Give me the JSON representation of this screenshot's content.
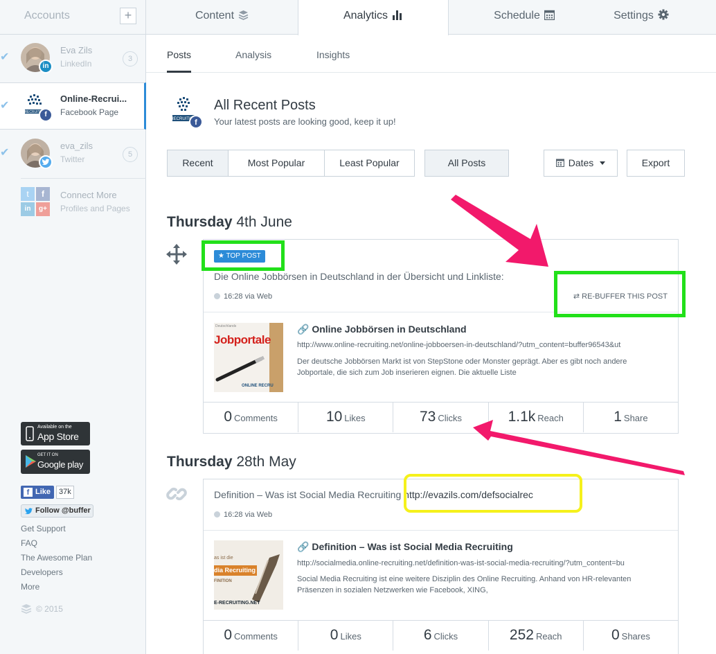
{
  "sidebar": {
    "title": "Accounts",
    "add_icon": "plus-icon",
    "accounts": [
      {
        "name": "Eva Zils",
        "network": "LinkedIn",
        "count": "3",
        "network_icon": "linkedin-icon"
      },
      {
        "name": "Online-Recrui...",
        "network": "Facebook Page",
        "network_icon": "facebook-icon"
      },
      {
        "name": "eva_zils",
        "network": "Twitter",
        "count": "5",
        "network_icon": "twitter-icon"
      }
    ],
    "connect": {
      "title": "Connect More",
      "sub": "Profiles and Pages"
    },
    "appstore": {
      "line1": "Available on the",
      "line2": "App Store"
    },
    "googleplay": {
      "line1": "GET IT ON",
      "line2": "Google play"
    },
    "fb_like": {
      "label": "Like",
      "count": "37k"
    },
    "tw_follow": {
      "label": "Follow @buffer"
    },
    "links": [
      "Get Support",
      "FAQ",
      "The Awesome Plan",
      "Developers",
      "More"
    ],
    "copyright": "© 2015"
  },
  "topnav": {
    "tabs": [
      {
        "label": "Content",
        "icon": "stack-icon"
      },
      {
        "label": "Analytics",
        "icon": "bar-chart-icon"
      },
      {
        "label": "Schedule",
        "icon": "calendar-icon"
      },
      {
        "label": "Settings",
        "icon": "gear-icon"
      }
    ],
    "active": "Analytics"
  },
  "subtabs": [
    "Posts",
    "Analysis",
    "Insights"
  ],
  "header": {
    "title": "All Recent Posts",
    "subtitle": "Your latest posts are looking good, keep it up!"
  },
  "filters": {
    "sort": [
      "Recent",
      "Most Popular",
      "Least Popular"
    ],
    "scope": "All Posts",
    "dates": "Dates",
    "export": "Export"
  },
  "days": [
    {
      "weekday": "Thursday",
      "date": "4th June",
      "post": {
        "badge": "TOP POST",
        "text": "Die Online Jobbörsen in Deutschland in der Übersicht und Linkliste:",
        "meta": "16:28 via Web",
        "rebuffer": "RE-BUFFER THIS POST",
        "thumb_text": "Jobportale",
        "thumb_small": "Deutschlands",
        "thumb_brand": "ONLINE RECRU",
        "link_title": "Online Jobbörsen in Deutschland",
        "link_url": "http://www.online-recruiting.net/online-jobboersen-in-deutschland/?utm_content=buffer96543&ut",
        "link_desc": "Der deutsche Jobbörsen Markt ist von StepStone oder Monster geprägt. Aber es gibt noch andere Jobportale, die sich zum Job inserieren eignen. Die aktuelle Liste",
        "stats": [
          {
            "n": "0",
            "label": "Comments"
          },
          {
            "n": "10",
            "label": "Likes"
          },
          {
            "n": "73",
            "label": "Clicks"
          },
          {
            "n": "1.1k",
            "label": "Reach"
          },
          {
            "n": "1",
            "label": "Share"
          }
        ]
      }
    },
    {
      "weekday": "Thursday",
      "date": "28th May",
      "post": {
        "text_plain": "Definition – Was ist Social Media Recruiting",
        "text_link": "http://evazils.com/defsocialrec",
        "meta": "16:28 via Web",
        "thumb_line1": "as ist die",
        "thumb_line2": "dia Recruiting",
        "thumb_line3": "FINITION",
        "thumb_brand": "E-RECRUITING.NET",
        "link_title": "Definition – Was ist Social Media Recruiting",
        "link_url": "http://socialmedia.online-recruiting.net/definition-was-ist-social-media-recruiting/?utm_content=bu",
        "link_desc": "Social Media Recruiting ist eine weitere Disziplin des Online Recruiting. Anhand von HR-relevanten Präsenzen in sozialen Netzwerken wie Facebook, XING,",
        "stats": [
          {
            "n": "0",
            "label": "Comments"
          },
          {
            "n": "0",
            "label": "Likes"
          },
          {
            "n": "6",
            "label": "Clicks"
          },
          {
            "n": "252",
            "label": "Reach"
          },
          {
            "n": "0",
            "label": "Shares"
          }
        ]
      }
    }
  ],
  "annotation_colors": {
    "arrow": "#f2196b",
    "green_box": "#22e01a",
    "yellow_box": "#f5f11c"
  }
}
